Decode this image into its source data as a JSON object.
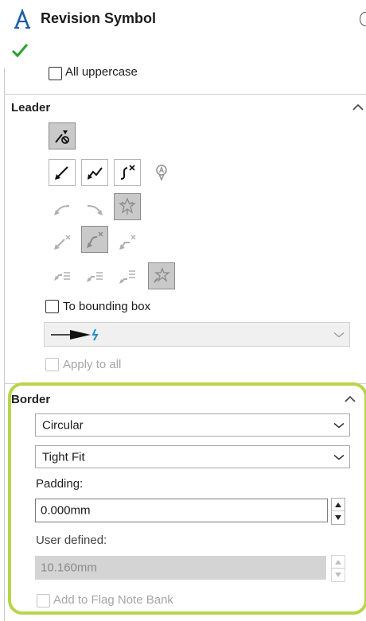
{
  "header": {
    "title": "Revision Symbol"
  },
  "text_options": {
    "all_uppercase_label": "All uppercase"
  },
  "leader": {
    "section_title": "Leader",
    "to_bounding_box_label": "To bounding box",
    "apply_to_all_label": "Apply to all"
  },
  "border": {
    "section_title": "Border",
    "shape_value": "Circular",
    "size_value": "Tight Fit",
    "padding_label": "Padding:",
    "padding_value": "0.000mm",
    "user_defined_label": "User defined:",
    "user_defined_value": "10.160mm",
    "add_to_flag_note_bank_label": "Add to Flag Note Bank"
  },
  "colors": {
    "highlight_outline": "#b8d44a",
    "ok_check": "#2e9e2e",
    "arrow_accent": "#1a8fd0"
  }
}
